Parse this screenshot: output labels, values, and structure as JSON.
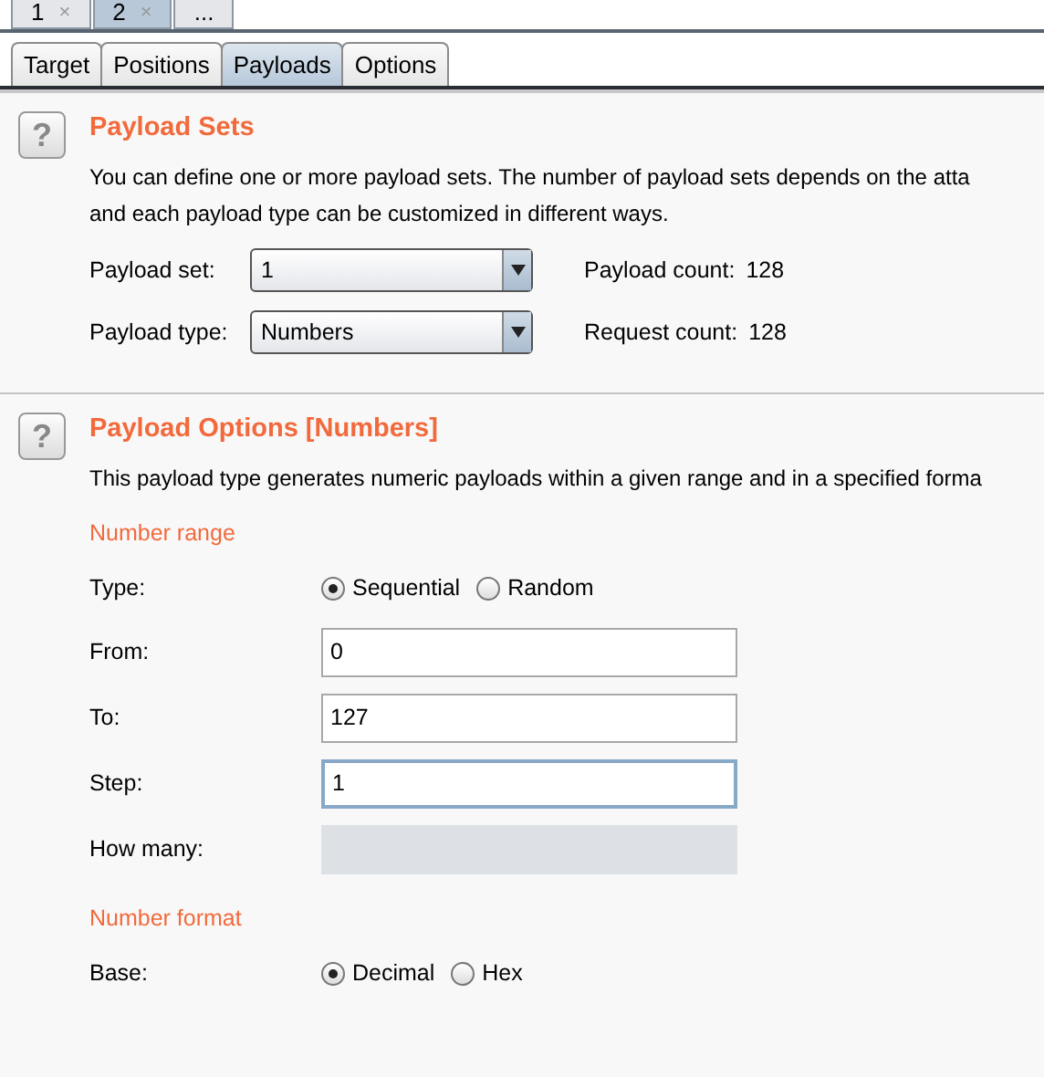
{
  "attack_tabs": [
    {
      "label": "1",
      "close": "×",
      "selected": false
    },
    {
      "label": "2",
      "close": "×",
      "selected": true
    },
    {
      "label": "...",
      "selected": false
    }
  ],
  "tabs": [
    {
      "label": "Target",
      "selected": false
    },
    {
      "label": "Positions",
      "selected": false
    },
    {
      "label": "Payloads",
      "selected": true
    },
    {
      "label": "Options",
      "selected": false
    }
  ],
  "payload_sets": {
    "title": "Payload Sets",
    "help": "?",
    "description": "You can define one or more payload sets. The number of payload sets depends on the atta",
    "description_2": "and each payload type can be customized in different ways.",
    "rows": [
      {
        "label": "Payload set:",
        "value": "1",
        "count_label": "Payload count:",
        "count": "128"
      },
      {
        "label": "Payload type:",
        "value": "Numbers",
        "count_label": "Request count:",
        "count": "128"
      }
    ]
  },
  "payload_options": {
    "title": "Payload Options [Numbers]",
    "help": "?",
    "description": "This payload type generates numeric payloads within a given range and in a specified forma",
    "groups": [
      {
        "title": "Number range",
        "rows": [
          {
            "kind": "radio",
            "label": "Type:",
            "options": [
              {
                "label": "Sequential",
                "selected": true
              },
              {
                "label": "Random",
                "selected": false
              }
            ]
          },
          {
            "kind": "text",
            "label": "From:",
            "value": "0",
            "focused": false,
            "disabled": false
          },
          {
            "kind": "text",
            "label": "To:",
            "value": "127",
            "focused": false,
            "disabled": false
          },
          {
            "kind": "text",
            "label": "Step:",
            "value": "1",
            "focused": true,
            "disabled": false
          },
          {
            "kind": "text",
            "label": "How many:",
            "focused": false,
            "disabled": true
          }
        ]
      },
      {
        "title": "Number format",
        "rows": [
          {
            "kind": "radio",
            "label": "Base:",
            "options": [
              {
                "label": "Decimal",
                "selected": true
              },
              {
                "label": "Hex",
                "selected": false
              }
            ]
          }
        ]
      }
    ]
  }
}
